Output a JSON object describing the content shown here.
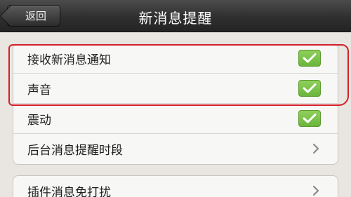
{
  "navbar": {
    "back_label": "返回",
    "title": "新消息提醒"
  },
  "settings": {
    "group1": [
      {
        "label": "接收新消息通知",
        "control": "checkbox",
        "checked": true
      },
      {
        "label": "声音",
        "control": "checkbox",
        "checked": true
      },
      {
        "label": "震动",
        "control": "checkbox",
        "checked": true
      },
      {
        "label": "后台消息提醒时段",
        "control": "chevron"
      }
    ],
    "group2": [
      {
        "label": "插件消息免打扰",
        "control": "chevron"
      }
    ]
  },
  "colors": {
    "navbar": "#2f2f2f",
    "check_green": "#7dc34a",
    "highlight_red": "#d4202a",
    "background": "#e9e6e1"
  },
  "icons": {
    "check": "checkmark-icon",
    "chevron": "chevron-right-icon"
  }
}
